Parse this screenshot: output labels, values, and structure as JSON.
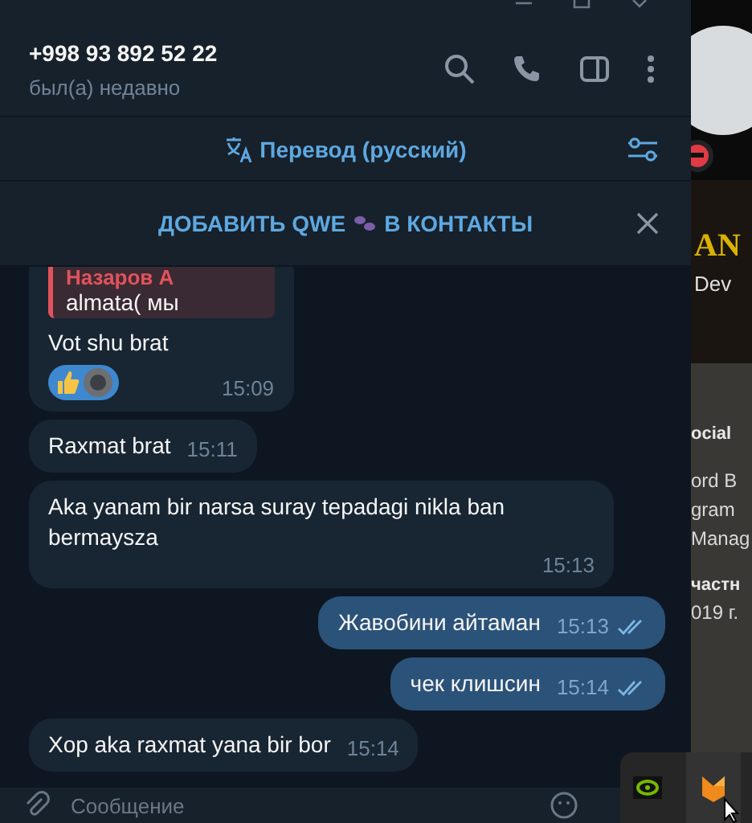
{
  "header": {
    "title": "+998 93 892 52 22",
    "status": "был(а) недавно"
  },
  "translate_bar": {
    "label": "Перевод (русский)"
  },
  "add_contact_bar": {
    "label_before": "ДОБАВИТЬ QWE",
    "label_after": "В КОНТАКТЫ"
  },
  "messages": [
    {
      "kind": "incoming",
      "reply": {
        "author": "Назаров А",
        "text": "almata( мы"
      },
      "text": "Vot shu brat",
      "has_reactions": true,
      "time": "15:09"
    },
    {
      "kind": "incoming",
      "text": "Raxmat brat",
      "time": "15:11"
    },
    {
      "kind": "incoming",
      "text": "Aka yanam bir narsa suray tepadagi nikla ban bermaysza",
      "time": "15:13"
    },
    {
      "kind": "outgoing",
      "text": "Жавобини айтаман",
      "time": "15:13",
      "read": true
    },
    {
      "kind": "outgoing",
      "text": "чек клишсин",
      "time": "15:14",
      "read": true
    },
    {
      "kind": "incoming",
      "text": "Xop aka raxmat yana bir bor",
      "time": "15:14"
    }
  ],
  "composer": {
    "placeholder": "Сообщение"
  },
  "background_page": {
    "heading": "AN",
    "texts": [
      "Dev",
      "ocial",
      "ord B",
      "gram",
      "Manag",
      "частн",
      "019 г."
    ]
  }
}
